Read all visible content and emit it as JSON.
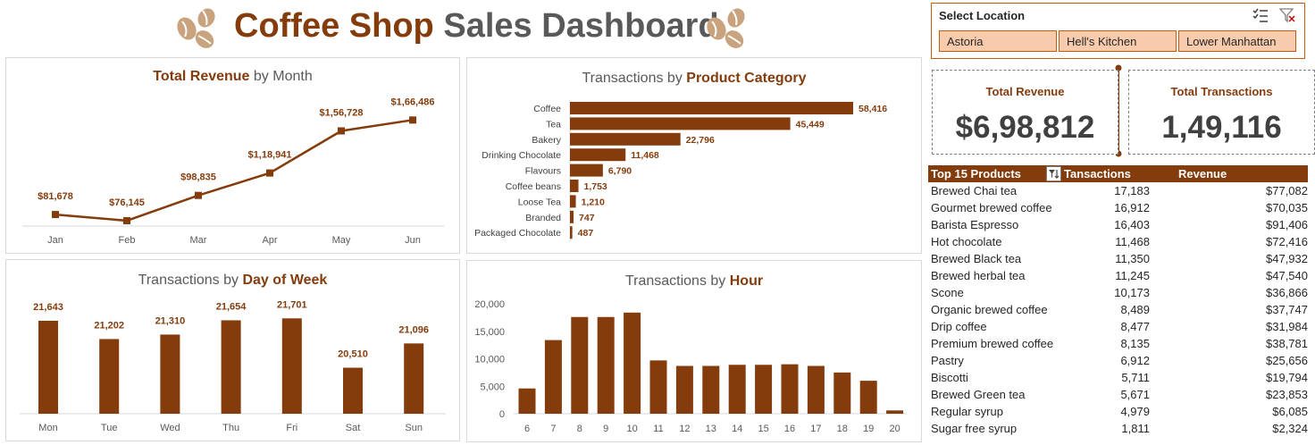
{
  "header": {
    "title_part1": "Coffee Shop",
    "title_part2": "Sales Dashboard",
    "left_icon": "coffee-beans-icon",
    "right_icon": "coffee-beans-icon"
  },
  "colors": {
    "brown": "#843C0C",
    "light_orange": "#F8CBAD",
    "grey_text": "#595959"
  },
  "slicer": {
    "title": "Select Location",
    "icons": [
      "multi-select-icon",
      "clear-filter-icon"
    ],
    "options": [
      "Astoria",
      "Hell's Kitchen",
      "Lower Manhattan"
    ]
  },
  "kpis": {
    "revenue_label": "Total Revenue",
    "revenue_value": "$6,98,812",
    "transactions_label": "Total Transactions",
    "transactions_value": "1,49,116"
  },
  "top_products": {
    "headers": {
      "product": "Top 15 Products",
      "transactions": "Tansactions",
      "revenue": "Revenue"
    },
    "filter_icon": "sort-filter-icon",
    "rows": [
      {
        "product": "Brewed Chai tea",
        "transactions": "17,183",
        "revenue": "$77,082"
      },
      {
        "product": "Gourmet brewed coffee",
        "transactions": "16,912",
        "revenue": "$70,035"
      },
      {
        "product": "Barista Espresso",
        "transactions": "16,403",
        "revenue": "$91,406"
      },
      {
        "product": "Hot chocolate",
        "transactions": "11,468",
        "revenue": "$72,416"
      },
      {
        "product": "Brewed Black tea",
        "transactions": "11,350",
        "revenue": "$47,932"
      },
      {
        "product": "Brewed herbal tea",
        "transactions": "11,245",
        "revenue": "$47,540"
      },
      {
        "product": "Scone",
        "transactions": "10,173",
        "revenue": "$36,866"
      },
      {
        "product": "Organic brewed coffee",
        "transactions": "8,489",
        "revenue": "$37,747"
      },
      {
        "product": "Drip coffee",
        "transactions": "8,477",
        "revenue": "$31,984"
      },
      {
        "product": "Premium brewed coffee",
        "transactions": "8,135",
        "revenue": "$38,781"
      },
      {
        "product": "Pastry",
        "transactions": "6,912",
        "revenue": "$25,656"
      },
      {
        "product": "Biscotti",
        "transactions": "5,711",
        "revenue": "$19,794"
      },
      {
        "product": "Brewed Green tea",
        "transactions": "5,671",
        "revenue": "$23,853"
      },
      {
        "product": "Regular syrup",
        "transactions": "4,979",
        "revenue": "$6,085"
      },
      {
        "product": "Sugar free syrup",
        "transactions": "1,811",
        "revenue": "$2,324"
      }
    ]
  },
  "chart_data": [
    {
      "id": "revenue",
      "type": "line",
      "title_bold": "Total Revenue",
      "title_rest": " by Month",
      "categories": [
        "Jan",
        "Feb",
        "Mar",
        "Apr",
        "May",
        "Jun"
      ],
      "values": [
        81678,
        76145,
        98835,
        118941,
        156728,
        166486
      ],
      "labels": [
        "$81,678",
        "$76,145",
        "$98,835",
        "$1,18,941",
        "$1,56,728",
        "$1,66,486"
      ],
      "ylim": [
        20000,
        190000
      ],
      "grid": false
    },
    {
      "id": "category",
      "type": "bar",
      "orientation": "horizontal",
      "title_rest": "Transactions by ",
      "title_bold": "Product Category",
      "categories": [
        "Coffee",
        "Tea",
        "Bakery",
        "Drinking Chocolate",
        "Flavours",
        "Coffee beans",
        "Loose Tea",
        "Branded",
        "Packaged Chocolate"
      ],
      "values": [
        58416,
        45449,
        22796,
        11468,
        6790,
        1753,
        1210,
        747,
        487
      ],
      "labels": [
        "58,416",
        "45,449",
        "22,796",
        "11,468",
        "6,790",
        "1,753",
        "1,210",
        "747",
        "487"
      ],
      "xlim": [
        0,
        58416
      ],
      "grid": false
    },
    {
      "id": "dow",
      "type": "bar",
      "title_rest": "Transactions by ",
      "title_bold": "Day of Week",
      "categories": [
        "Mon",
        "Tue",
        "Wed",
        "Thu",
        "Fri",
        "Sat",
        "Sun"
      ],
      "values": [
        21643,
        21202,
        21310,
        21654,
        21701,
        20510,
        21096
      ],
      "labels": [
        "21,643",
        "21,202",
        "21,310",
        "21,654",
        "21,701",
        "20,510",
        "21,096"
      ],
      "ylim": [
        19400,
        21750
      ],
      "grid": false
    },
    {
      "id": "hour",
      "type": "bar",
      "title_rest": "Transactions by ",
      "title_bold": "Hour",
      "categories": [
        "6",
        "7",
        "8",
        "9",
        "10",
        "11",
        "12",
        "13",
        "14",
        "15",
        "16",
        "17",
        "18",
        "19",
        "20"
      ],
      "values": [
        4600,
        13400,
        17600,
        17600,
        18400,
        9700,
        8700,
        8700,
        8900,
        8900,
        9000,
        8700,
        7500,
        6000,
        600
      ],
      "ylim": [
        0,
        20000
      ],
      "yticks": [
        "0",
        "5,000",
        "10,000",
        "15,000",
        "20,000"
      ],
      "grid": false
    }
  ]
}
